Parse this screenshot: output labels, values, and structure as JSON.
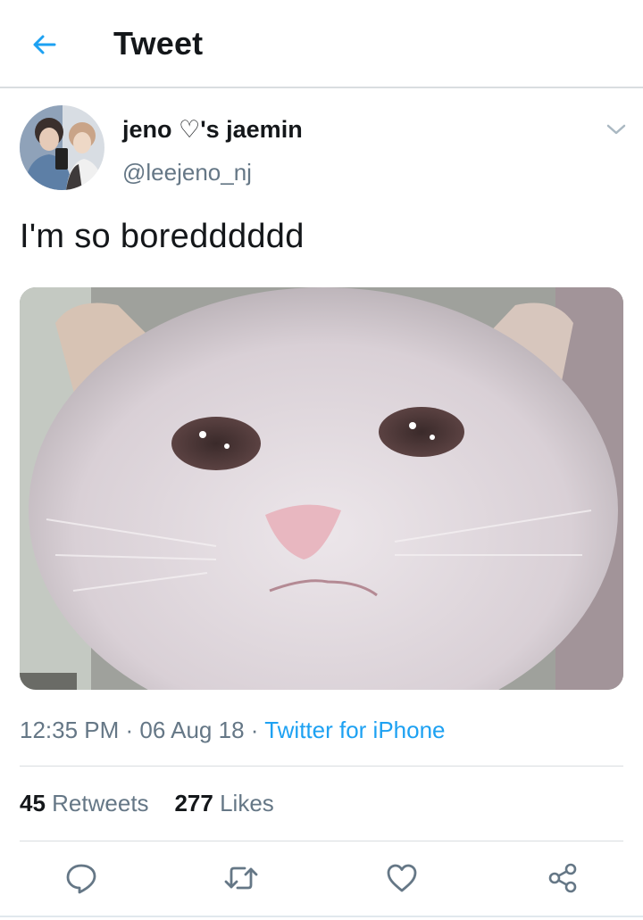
{
  "header": {
    "title": "Tweet",
    "back_icon": "back-arrow-icon",
    "accent_color": "#1da1f2"
  },
  "tweet": {
    "author": {
      "name": "jeno ♡'s jaemin",
      "handle": "@leejeno_nj"
    },
    "text": "I'm so boredddddd",
    "time": "12:35 PM",
    "date": "06 Aug 18",
    "source": "Twitter for iPhone",
    "stats": {
      "retweets_count": "45",
      "retweets_label": "Retweets",
      "likes_count": "277",
      "likes_label": "Likes"
    },
    "actions": [
      "reply-icon",
      "retweet-icon",
      "like-icon",
      "share-icon"
    ]
  }
}
